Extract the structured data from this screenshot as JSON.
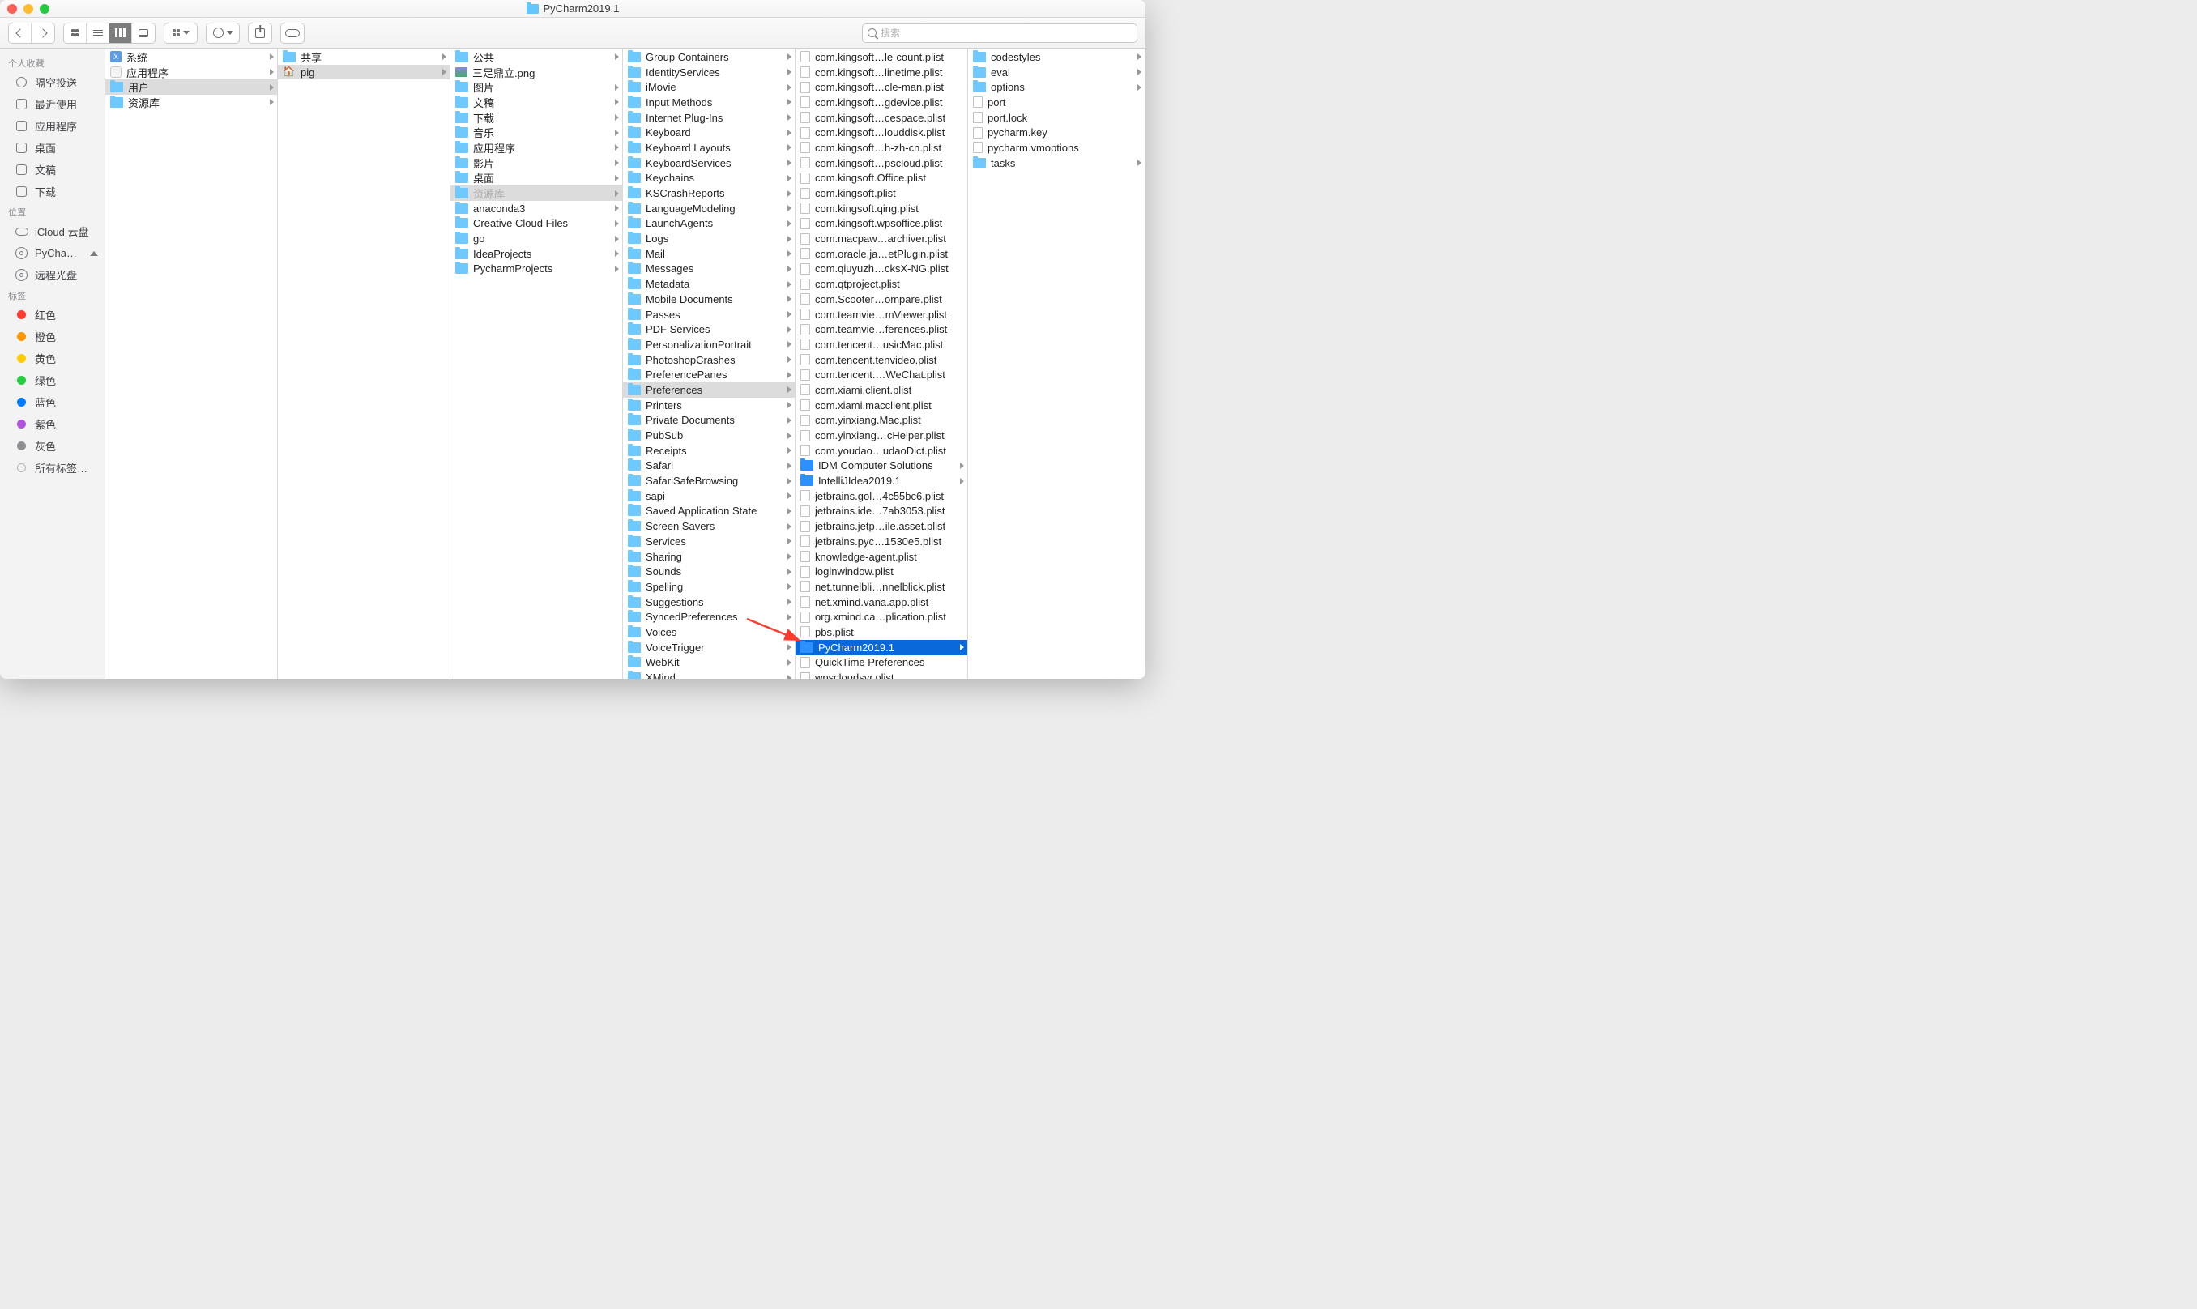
{
  "title": "PyCharm2019.1",
  "search_placeholder": "搜索",
  "sidebar": {
    "favorites_label": "个人收藏",
    "favorites": [
      {
        "label": "隔空投送",
        "icon": "ring"
      },
      {
        "label": "最近使用",
        "icon": "recents"
      },
      {
        "label": "应用程序",
        "icon": "apps"
      },
      {
        "label": "桌面",
        "icon": "desktop"
      },
      {
        "label": "文稿",
        "icon": "docs"
      },
      {
        "label": "下载",
        "icon": "downloads"
      }
    ],
    "locations_label": "位置",
    "locations": [
      {
        "label": "iCloud 云盘",
        "icon": "cloud"
      },
      {
        "label": "PyCha…",
        "icon": "disk",
        "eject": true
      },
      {
        "label": "远程光盘",
        "icon": "disk"
      }
    ],
    "tags_label": "标签",
    "tags": [
      {
        "label": "红色",
        "color": "#ff3b30"
      },
      {
        "label": "橙色",
        "color": "#ff9500"
      },
      {
        "label": "黄色",
        "color": "#ffcc00"
      },
      {
        "label": "绿色",
        "color": "#28cd41"
      },
      {
        "label": "蓝色",
        "color": "#007aff"
      },
      {
        "label": "紫色",
        "color": "#af52de"
      },
      {
        "label": "灰色",
        "color": "#8e8e93"
      },
      {
        "label": "所有标签…",
        "color": ""
      }
    ]
  },
  "columns": {
    "c1": [
      {
        "label": "系统",
        "icon": "xfile",
        "has_children": true
      },
      {
        "label": "应用程序",
        "icon": "app",
        "has_children": true
      },
      {
        "label": "用户",
        "icon": "folder",
        "has_children": true,
        "selected": "gray"
      },
      {
        "label": "资源库",
        "icon": "folder",
        "has_children": true
      }
    ],
    "c2": [
      {
        "label": "共享",
        "icon": "folder",
        "has_children": true
      },
      {
        "label": "pig",
        "icon": "home",
        "has_children": true,
        "selected": "gray"
      }
    ],
    "c3": [
      {
        "label": "公共",
        "icon": "folder",
        "has_children": true
      },
      {
        "label": "三足鼎立.png",
        "icon": "img"
      },
      {
        "label": "图片",
        "icon": "folder",
        "has_children": true
      },
      {
        "label": "文稿",
        "icon": "folder",
        "has_children": true
      },
      {
        "label": "下载",
        "icon": "folder",
        "has_children": true
      },
      {
        "label": "音乐",
        "icon": "folder",
        "has_children": true
      },
      {
        "label": "应用程序",
        "icon": "folder",
        "has_children": true
      },
      {
        "label": "影片",
        "icon": "folder",
        "has_children": true
      },
      {
        "label": "桌面",
        "icon": "folder",
        "has_children": true
      },
      {
        "label": "资源库",
        "icon": "folder",
        "has_children": true,
        "selected": "gray",
        "dimmed": true
      },
      {
        "label": "anaconda3",
        "icon": "folder",
        "has_children": true
      },
      {
        "label": "Creative Cloud Files",
        "icon": "folder",
        "has_children": true
      },
      {
        "label": "go",
        "icon": "folder",
        "has_children": true
      },
      {
        "label": "IdeaProjects",
        "icon": "folder",
        "has_children": true
      },
      {
        "label": "PycharmProjects",
        "icon": "folder",
        "has_children": true
      }
    ],
    "c4": [
      {
        "label": "Group Containers",
        "icon": "folder",
        "has_children": true
      },
      {
        "label": "IdentityServices",
        "icon": "folder",
        "has_children": true
      },
      {
        "label": "iMovie",
        "icon": "folder",
        "has_children": true
      },
      {
        "label": "Input Methods",
        "icon": "folder",
        "has_children": true
      },
      {
        "label": "Internet Plug-Ins",
        "icon": "folder",
        "has_children": true
      },
      {
        "label": "Keyboard",
        "icon": "folder",
        "has_children": true
      },
      {
        "label": "Keyboard Layouts",
        "icon": "folder",
        "has_children": true
      },
      {
        "label": "KeyboardServices",
        "icon": "folder",
        "has_children": true
      },
      {
        "label": "Keychains",
        "icon": "folder",
        "has_children": true
      },
      {
        "label": "KSCrashReports",
        "icon": "folder",
        "has_children": true
      },
      {
        "label": "LanguageModeling",
        "icon": "folder",
        "has_children": true
      },
      {
        "label": "LaunchAgents",
        "icon": "folder",
        "has_children": true
      },
      {
        "label": "Logs",
        "icon": "folder",
        "has_children": true
      },
      {
        "label": "Mail",
        "icon": "folder",
        "has_children": true
      },
      {
        "label": "Messages",
        "icon": "folder",
        "has_children": true
      },
      {
        "label": "Metadata",
        "icon": "folder",
        "has_children": true
      },
      {
        "label": "Mobile Documents",
        "icon": "folder",
        "has_children": true
      },
      {
        "label": "Passes",
        "icon": "folder",
        "has_children": true
      },
      {
        "label": "PDF Services",
        "icon": "folder",
        "has_children": true
      },
      {
        "label": "PersonalizationPortrait",
        "icon": "folder",
        "has_children": true
      },
      {
        "label": "PhotoshopCrashes",
        "icon": "folder",
        "has_children": true
      },
      {
        "label": "PreferencePanes",
        "icon": "folder",
        "has_children": true
      },
      {
        "label": "Preferences",
        "icon": "folder",
        "has_children": true,
        "selected": "gray"
      },
      {
        "label": "Printers",
        "icon": "folder",
        "has_children": true
      },
      {
        "label": "Private Documents",
        "icon": "folder",
        "has_children": true
      },
      {
        "label": "PubSub",
        "icon": "folder",
        "has_children": true
      },
      {
        "label": "Receipts",
        "icon": "folder",
        "has_children": true
      },
      {
        "label": "Safari",
        "icon": "folder",
        "has_children": true
      },
      {
        "label": "SafariSafeBrowsing",
        "icon": "folder",
        "has_children": true
      },
      {
        "label": "sapi",
        "icon": "folder",
        "has_children": true
      },
      {
        "label": "Saved Application State",
        "icon": "folder",
        "has_children": true
      },
      {
        "label": "Screen Savers",
        "icon": "folder",
        "has_children": true
      },
      {
        "label": "Services",
        "icon": "folder",
        "has_children": true
      },
      {
        "label": "Sharing",
        "icon": "folder",
        "has_children": true
      },
      {
        "label": "Sounds",
        "icon": "folder",
        "has_children": true
      },
      {
        "label": "Spelling",
        "icon": "folder",
        "has_children": true
      },
      {
        "label": "Suggestions",
        "icon": "folder",
        "has_children": true
      },
      {
        "label": "SyncedPreferences",
        "icon": "folder",
        "has_children": true
      },
      {
        "label": "Voices",
        "icon": "folder",
        "has_children": true
      },
      {
        "label": "VoiceTrigger",
        "icon": "folder",
        "has_children": true
      },
      {
        "label": "WebKit",
        "icon": "folder",
        "has_children": true
      },
      {
        "label": "XMind",
        "icon": "folder",
        "has_children": true
      }
    ],
    "c5": [
      {
        "label": "com.kingsoft…le-count.plist",
        "icon": "file"
      },
      {
        "label": "com.kingsoft…linetime.plist",
        "icon": "file"
      },
      {
        "label": "com.kingsoft…cle-man.plist",
        "icon": "file"
      },
      {
        "label": "com.kingsoft…gdevice.plist",
        "icon": "file"
      },
      {
        "label": "com.kingsoft…cespace.plist",
        "icon": "file"
      },
      {
        "label": "com.kingsoft…louddisk.plist",
        "icon": "file"
      },
      {
        "label": "com.kingsoft…h-zh-cn.plist",
        "icon": "file"
      },
      {
        "label": "com.kingsoft…pscloud.plist",
        "icon": "file"
      },
      {
        "label": "com.kingsoft.Office.plist",
        "icon": "file"
      },
      {
        "label": "com.kingsoft.plist",
        "icon": "file"
      },
      {
        "label": "com.kingsoft.qing.plist",
        "icon": "file"
      },
      {
        "label": "com.kingsoft.wpsoffice.plist",
        "icon": "file"
      },
      {
        "label": "com.macpaw…archiver.plist",
        "icon": "file"
      },
      {
        "label": "com.oracle.ja…etPlugin.plist",
        "icon": "file"
      },
      {
        "label": "com.qiuyuzh…cksX-NG.plist",
        "icon": "file"
      },
      {
        "label": "com.qtproject.plist",
        "icon": "file"
      },
      {
        "label": "com.Scooter…ompare.plist",
        "icon": "file"
      },
      {
        "label": "com.teamvie…mViewer.plist",
        "icon": "file"
      },
      {
        "label": "com.teamvie…ferences.plist",
        "icon": "file"
      },
      {
        "label": "com.tencent…usicMac.plist",
        "icon": "file"
      },
      {
        "label": "com.tencent.tenvideo.plist",
        "icon": "file"
      },
      {
        "label": "com.tencent.…WeChat.plist",
        "icon": "file"
      },
      {
        "label": "com.xiami.client.plist",
        "icon": "file"
      },
      {
        "label": "com.xiami.macclient.plist",
        "icon": "file"
      },
      {
        "label": "com.yinxiang.Mac.plist",
        "icon": "file"
      },
      {
        "label": "com.yinxiang…cHelper.plist",
        "icon": "file"
      },
      {
        "label": "com.youdao…udaoDict.plist",
        "icon": "file"
      },
      {
        "label": "IDM Computer Solutions",
        "icon": "folder-b",
        "has_children": true
      },
      {
        "label": "IntelliJIdea2019.1",
        "icon": "folder-b",
        "has_children": true
      },
      {
        "label": "jetbrains.gol…4c55bc6.plist",
        "icon": "file"
      },
      {
        "label": "jetbrains.ide…7ab3053.plist",
        "icon": "file"
      },
      {
        "label": "jetbrains.jetp…ile.asset.plist",
        "icon": "file"
      },
      {
        "label": "jetbrains.pyc…1530e5.plist",
        "icon": "file"
      },
      {
        "label": "knowledge-agent.plist",
        "icon": "file"
      },
      {
        "label": "loginwindow.plist",
        "icon": "file"
      },
      {
        "label": "net.tunnelbli…nnelblick.plist",
        "icon": "file"
      },
      {
        "label": "net.xmind.vana.app.plist",
        "icon": "file"
      },
      {
        "label": "org.xmind.ca…plication.plist",
        "icon": "file"
      },
      {
        "label": "pbs.plist",
        "icon": "file"
      },
      {
        "label": "PyCharm2019.1",
        "icon": "folder-b",
        "has_children": true,
        "selected": "blue"
      },
      {
        "label": "QuickTime Preferences",
        "icon": "file"
      },
      {
        "label": "wpscloudsvr.plist",
        "icon": "file"
      }
    ],
    "c6": [
      {
        "label": "codestyles",
        "icon": "folder",
        "has_children": true
      },
      {
        "label": "eval",
        "icon": "folder",
        "has_children": true
      },
      {
        "label": "options",
        "icon": "folder",
        "has_children": true
      },
      {
        "label": "port",
        "icon": "file"
      },
      {
        "label": "port.lock",
        "icon": "file"
      },
      {
        "label": "pycharm.key",
        "icon": "file"
      },
      {
        "label": "pycharm.vmoptions",
        "icon": "file"
      },
      {
        "label": "tasks",
        "icon": "folder",
        "has_children": true
      }
    ]
  }
}
